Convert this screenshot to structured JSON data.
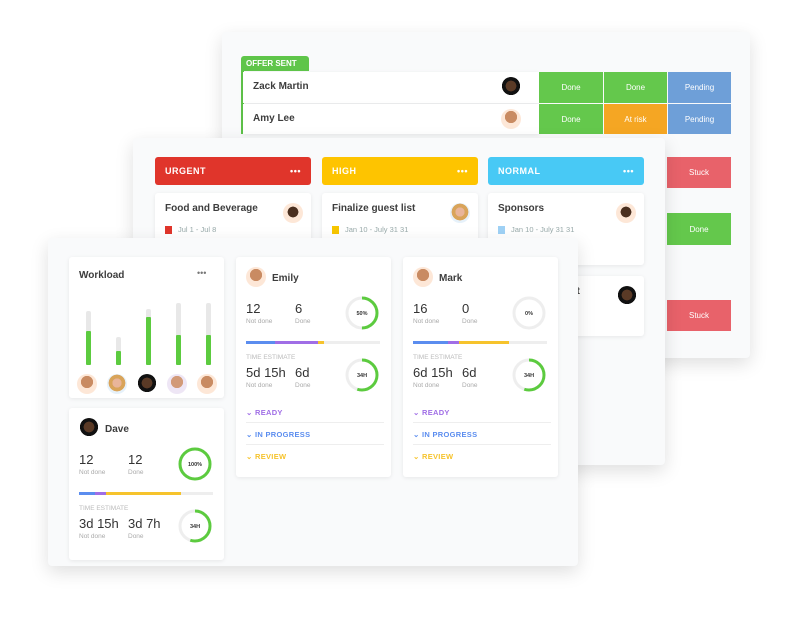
{
  "back": {
    "group_label": "OFFER SENT",
    "group_color": "#5fc54a",
    "rows": [
      {
        "name": "Zack Martin",
        "statuses": [
          "Done",
          "Done",
          "Pending"
        ]
      },
      {
        "name": "Amy Lee",
        "statuses": [
          "Done",
          "At risk",
          "Pending"
        ]
      }
    ],
    "right_statuses": [
      "Stuck",
      "Done",
      "Stuck"
    ],
    "status_colors": {
      "Done": "#64c84c",
      "At risk": "#f5a623",
      "Pending": "#6e9fd8",
      "Stuck": "#e8626a"
    }
  },
  "board": {
    "columns": [
      {
        "label": "URGENT",
        "color": "#e0352b",
        "flag_color": "#e0352b",
        "task": "Food and Beverage",
        "date": "Jul 1 - Jul 8"
      },
      {
        "label": "HIGH",
        "color": "#fec400",
        "flag_color": "#f7c600",
        "task": "Finalize guest list",
        "date": "Jan 10 - July 31 31"
      },
      {
        "label": "NORMAL",
        "color": "#48c9f5",
        "flag_color": "#9fd1f5",
        "task": "Sponsors",
        "date": "Jan 10 - July 31 31"
      }
    ],
    "partial_task": "st"
  },
  "workload": {
    "title": "Workload",
    "capacity_pct": [
      69,
      36,
      72,
      80,
      80
    ],
    "load_pct": [
      43,
      18,
      62,
      38,
      38
    ]
  },
  "people": [
    {
      "name": "Emily",
      "not_done": "12",
      "done": "6",
      "pct_label": "50%",
      "pct": 50,
      "progress": [
        {
          "c": "#5b8def",
          "w": 22
        },
        {
          "c": "#a06ee6",
          "w": 32
        },
        {
          "c": "#f6c32c",
          "w": 4
        }
      ],
      "time_label": "TIME ESTIMATE",
      "t_not_done": "5d 15h",
      "t_done": "6d",
      "hours": "34H",
      "hours_pct": 55,
      "not_done_label": "Not done",
      "done_label": "Done",
      "sections": [
        {
          "label": "READY",
          "color": "#a06ee6"
        },
        {
          "label": "IN PROGRESS",
          "color": "#5b8def"
        },
        {
          "label": "REVIEW",
          "color": "#f6c32c"
        }
      ]
    },
    {
      "name": "Mark",
      "not_done": "16",
      "done": "0",
      "pct_label": "0%",
      "pct": 0,
      "progress": [
        {
          "c": "#5b8def",
          "w": 26
        },
        {
          "c": "#a06ee6",
          "w": 8
        },
        {
          "c": "#f6c32c",
          "w": 38
        }
      ],
      "time_label": "TIME ESTIMATE",
      "t_not_done": "6d 15h",
      "t_done": "6d",
      "hours": "34H",
      "hours_pct": 55,
      "not_done_label": "Not done",
      "done_label": "Done",
      "sections": [
        {
          "label": "READY",
          "color": "#a06ee6"
        },
        {
          "label": "IN PROGRESS",
          "color": "#5b8def"
        },
        {
          "label": "REVIEW",
          "color": "#f6c32c"
        }
      ]
    },
    {
      "name": "Dave",
      "not_done": "12",
      "done": "12",
      "pct_label": "100%",
      "pct": 100,
      "progress": [
        {
          "c": "#5b8def",
          "w": 12
        },
        {
          "c": "#a06ee6",
          "w": 8
        },
        {
          "c": "#f6c32c",
          "w": 56
        }
      ],
      "time_label": "TIME ESTIMATE",
      "t_not_done": "3d 15h",
      "t_done": "3d 7h",
      "hours": "34H",
      "hours_pct": 55,
      "not_done_label": "Not done",
      "done_label": "Done"
    }
  ]
}
